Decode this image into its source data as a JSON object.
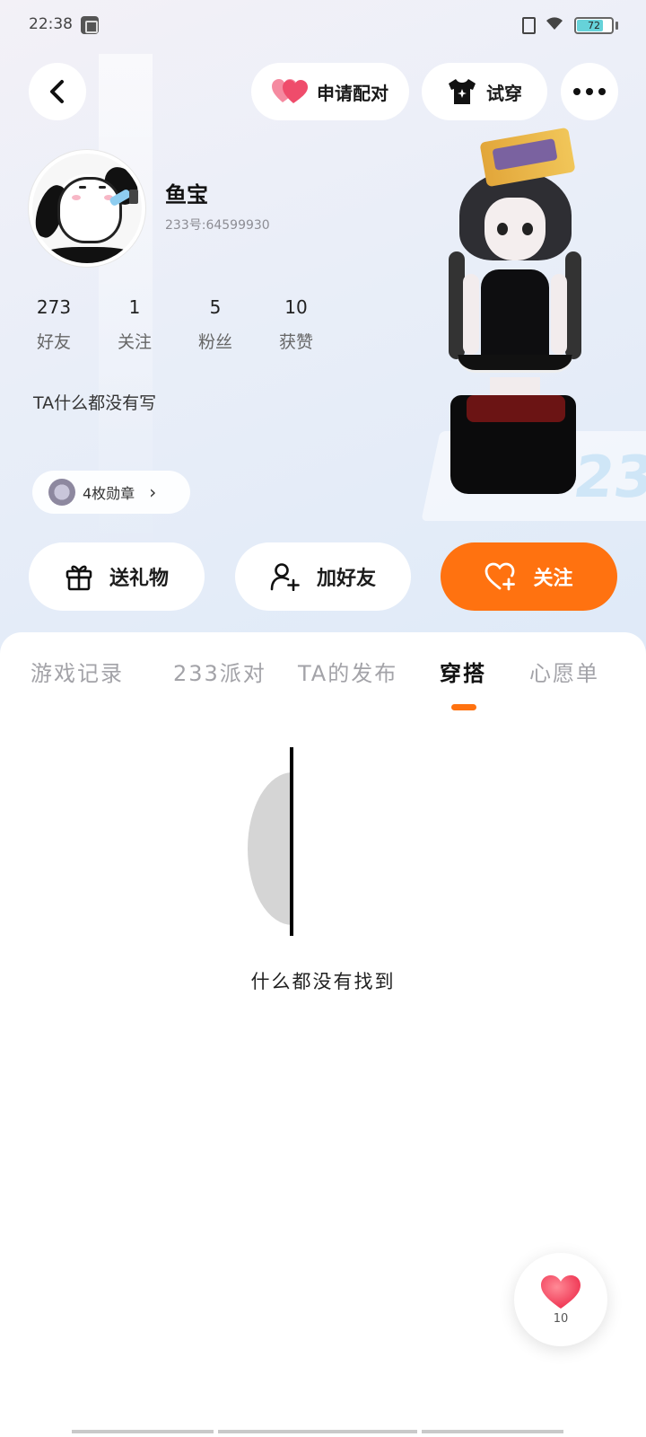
{
  "status_bar": {
    "time": "22:38",
    "battery": "72",
    "battery_level": 0.72
  },
  "header": {
    "back": "back",
    "match_label": "申请配对",
    "try_on_label": "试穿",
    "more": "more"
  },
  "profile": {
    "name": "鱼宝",
    "id_text": "233号:64599930",
    "stats": [
      {
        "value": "273",
        "label": "好友"
      },
      {
        "value": "1",
        "label": "关注"
      },
      {
        "value": "5",
        "label": "粉丝"
      },
      {
        "value": "10",
        "label": "获赞"
      }
    ],
    "bio": "TA什么都没有写",
    "medals": "4枚勋章"
  },
  "actions": {
    "gift": "送礼物",
    "add_friend": "加好友",
    "follow": "关注"
  },
  "tabs": [
    {
      "label": "游戏记录"
    },
    {
      "label": "233派对"
    },
    {
      "label": "TA的发布"
    },
    {
      "label": "穿搭",
      "active": true
    },
    {
      "label": "心愿单"
    }
  ],
  "empty_state": {
    "message": "什么都没有找到"
  },
  "like": {
    "count": "10"
  },
  "colors": {
    "accent": "#ff7210",
    "heart": "#f2526a"
  },
  "hero_text": "233"
}
